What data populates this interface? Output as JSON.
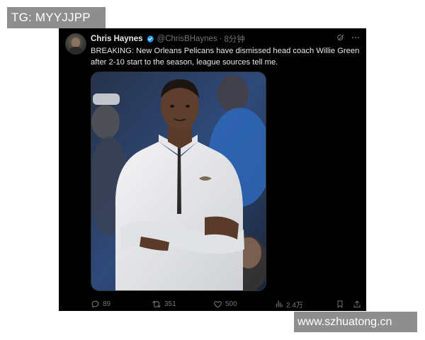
{
  "watermarks": {
    "top": "TG: MYYJJPP",
    "bottom": "www.szhuatong.cn"
  },
  "tweet": {
    "author": {
      "display_name": "Chris Haynes",
      "verified": true,
      "handle": "@ChrisBHaynes",
      "separator": "·",
      "time": "8分钟"
    },
    "text": "BREAKING: New Orleans Pelicans have dismissed head coach Willie Green after 2-10 start to the season, league sources tell me.",
    "media": {
      "description_icon": "photo-icon"
    },
    "metrics": {
      "replies": "89",
      "retweets": "351",
      "likes": "500",
      "views": "2.4万"
    }
  },
  "colors": {
    "background": "#000000",
    "text": "#e7e9ea",
    "muted": "#71767b",
    "verified": "#1d9bf0",
    "watermark_bg": "#8e8e8e"
  },
  "icons": {
    "verified": "verified-badge-icon",
    "grok": "grok-icon",
    "more": "more-horizontal-icon",
    "reply": "reply-icon",
    "retweet": "retweet-icon",
    "like": "heart-icon",
    "views": "views-chart-icon",
    "bookmark": "bookmark-icon",
    "share": "share-icon"
  }
}
